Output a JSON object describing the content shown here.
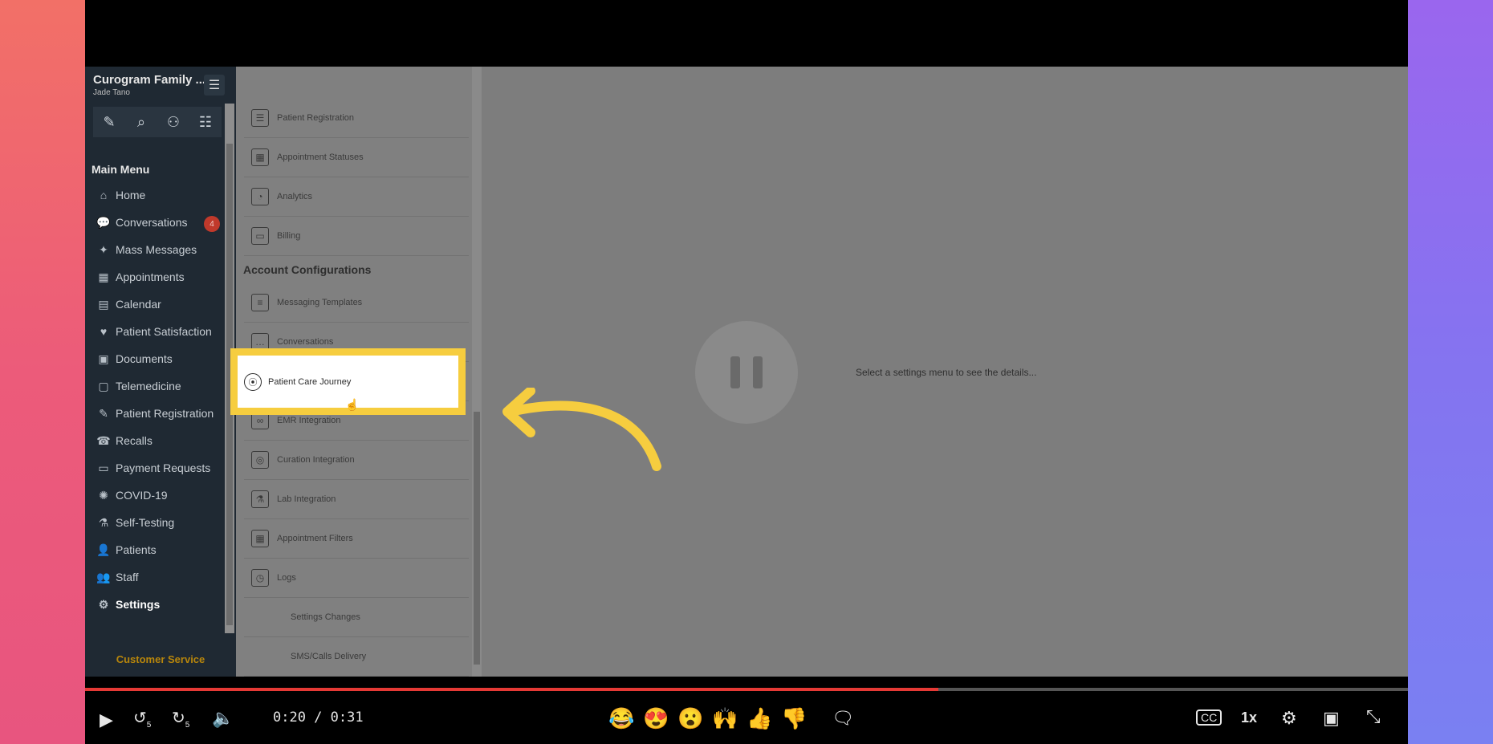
{
  "app": {
    "org_name": "Curogram Family ...",
    "user_name": "Jade Tano",
    "hamburger": "☰",
    "toolbar_icons": [
      "compose-icon",
      "search-icon",
      "user-icon",
      "filters-icon"
    ]
  },
  "main_menu": {
    "title": "Main Menu",
    "items": [
      {
        "label": "Home",
        "icon": "home-icon",
        "glyph": "⌂"
      },
      {
        "label": "Conversations",
        "icon": "chat-icon",
        "glyph": "💬",
        "badge": "4"
      },
      {
        "label": "Mass Messages",
        "icon": "broadcast-icon",
        "glyph": "✦"
      },
      {
        "label": "Appointments",
        "icon": "calendar-check-icon",
        "glyph": "▦"
      },
      {
        "label": "Calendar",
        "icon": "calendar-icon",
        "glyph": "▤"
      },
      {
        "label": "Patient Satisfaction",
        "icon": "heart-icon",
        "glyph": "♥"
      },
      {
        "label": "Documents",
        "icon": "documents-icon",
        "glyph": "▣"
      },
      {
        "label": "Telemedicine",
        "icon": "telemedicine-icon",
        "glyph": "▢"
      },
      {
        "label": "Patient Registration",
        "icon": "registration-icon",
        "glyph": "✎"
      },
      {
        "label": "Recalls",
        "icon": "phone-icon",
        "glyph": "☎"
      },
      {
        "label": "Payment Requests",
        "icon": "card-icon",
        "glyph": "▭"
      },
      {
        "label": "COVID-19",
        "icon": "virus-icon",
        "glyph": "✺"
      },
      {
        "label": "Self-Testing",
        "icon": "flask-icon",
        "glyph": "⚗"
      },
      {
        "label": "Patients",
        "icon": "person-icon",
        "glyph": "👤"
      },
      {
        "label": "Staff",
        "icon": "team-icon",
        "glyph": "👥"
      },
      {
        "label": "Settings",
        "icon": "gear-icon",
        "glyph": "⚙",
        "active": true
      }
    ],
    "customer_service": "Customer Service"
  },
  "settings": {
    "top_items": [
      {
        "label": "Patient Registration",
        "icon": "clipboard-icon",
        "glyph": "☰"
      },
      {
        "label": "Appointment Statuses",
        "icon": "calendar-status-icon",
        "glyph": "▦"
      },
      {
        "label": "Analytics",
        "icon": "pie-chart-icon",
        "glyph": "◔"
      },
      {
        "label": "Billing",
        "icon": "credit-card-icon",
        "glyph": "▭"
      }
    ],
    "section_title": "Account Configurations",
    "config_items": [
      {
        "label": "Messaging Templates",
        "icon": "template-icon",
        "glyph": "≡"
      },
      {
        "label": "Conversations",
        "icon": "chat-bubble-icon",
        "glyph": "…"
      },
      {
        "label": "Patient Care Journey",
        "icon": "journey-icon",
        "glyph": "⦿",
        "highlighted": true
      },
      {
        "label": "EMR Integration",
        "icon": "link-icon",
        "glyph": "∞"
      },
      {
        "label": "Curation Integration",
        "icon": "integration-icon",
        "glyph": "◎"
      },
      {
        "label": "Lab Integration",
        "icon": "flask-icon",
        "glyph": "⚗"
      },
      {
        "label": "Appointment Filters",
        "icon": "filter-calendar-icon",
        "glyph": "▦"
      },
      {
        "label": "Logs",
        "icon": "logs-icon",
        "glyph": "◷"
      }
    ],
    "sub_items": [
      {
        "label": "Settings Changes"
      },
      {
        "label": "SMS/Calls Delivery"
      }
    ]
  },
  "content": {
    "message": "Select a settings menu to see the details..."
  },
  "player": {
    "time": "0:20 / 0:31",
    "progress": 0.645,
    "speed": "1x",
    "rewind_label": "5",
    "forward_label": "5",
    "reactions": [
      "😂",
      "😍",
      "😮",
      "🙌",
      "👍",
      "👎"
    ],
    "colors": {
      "accent": "#f6cd3f",
      "progress": "#e53935"
    }
  }
}
